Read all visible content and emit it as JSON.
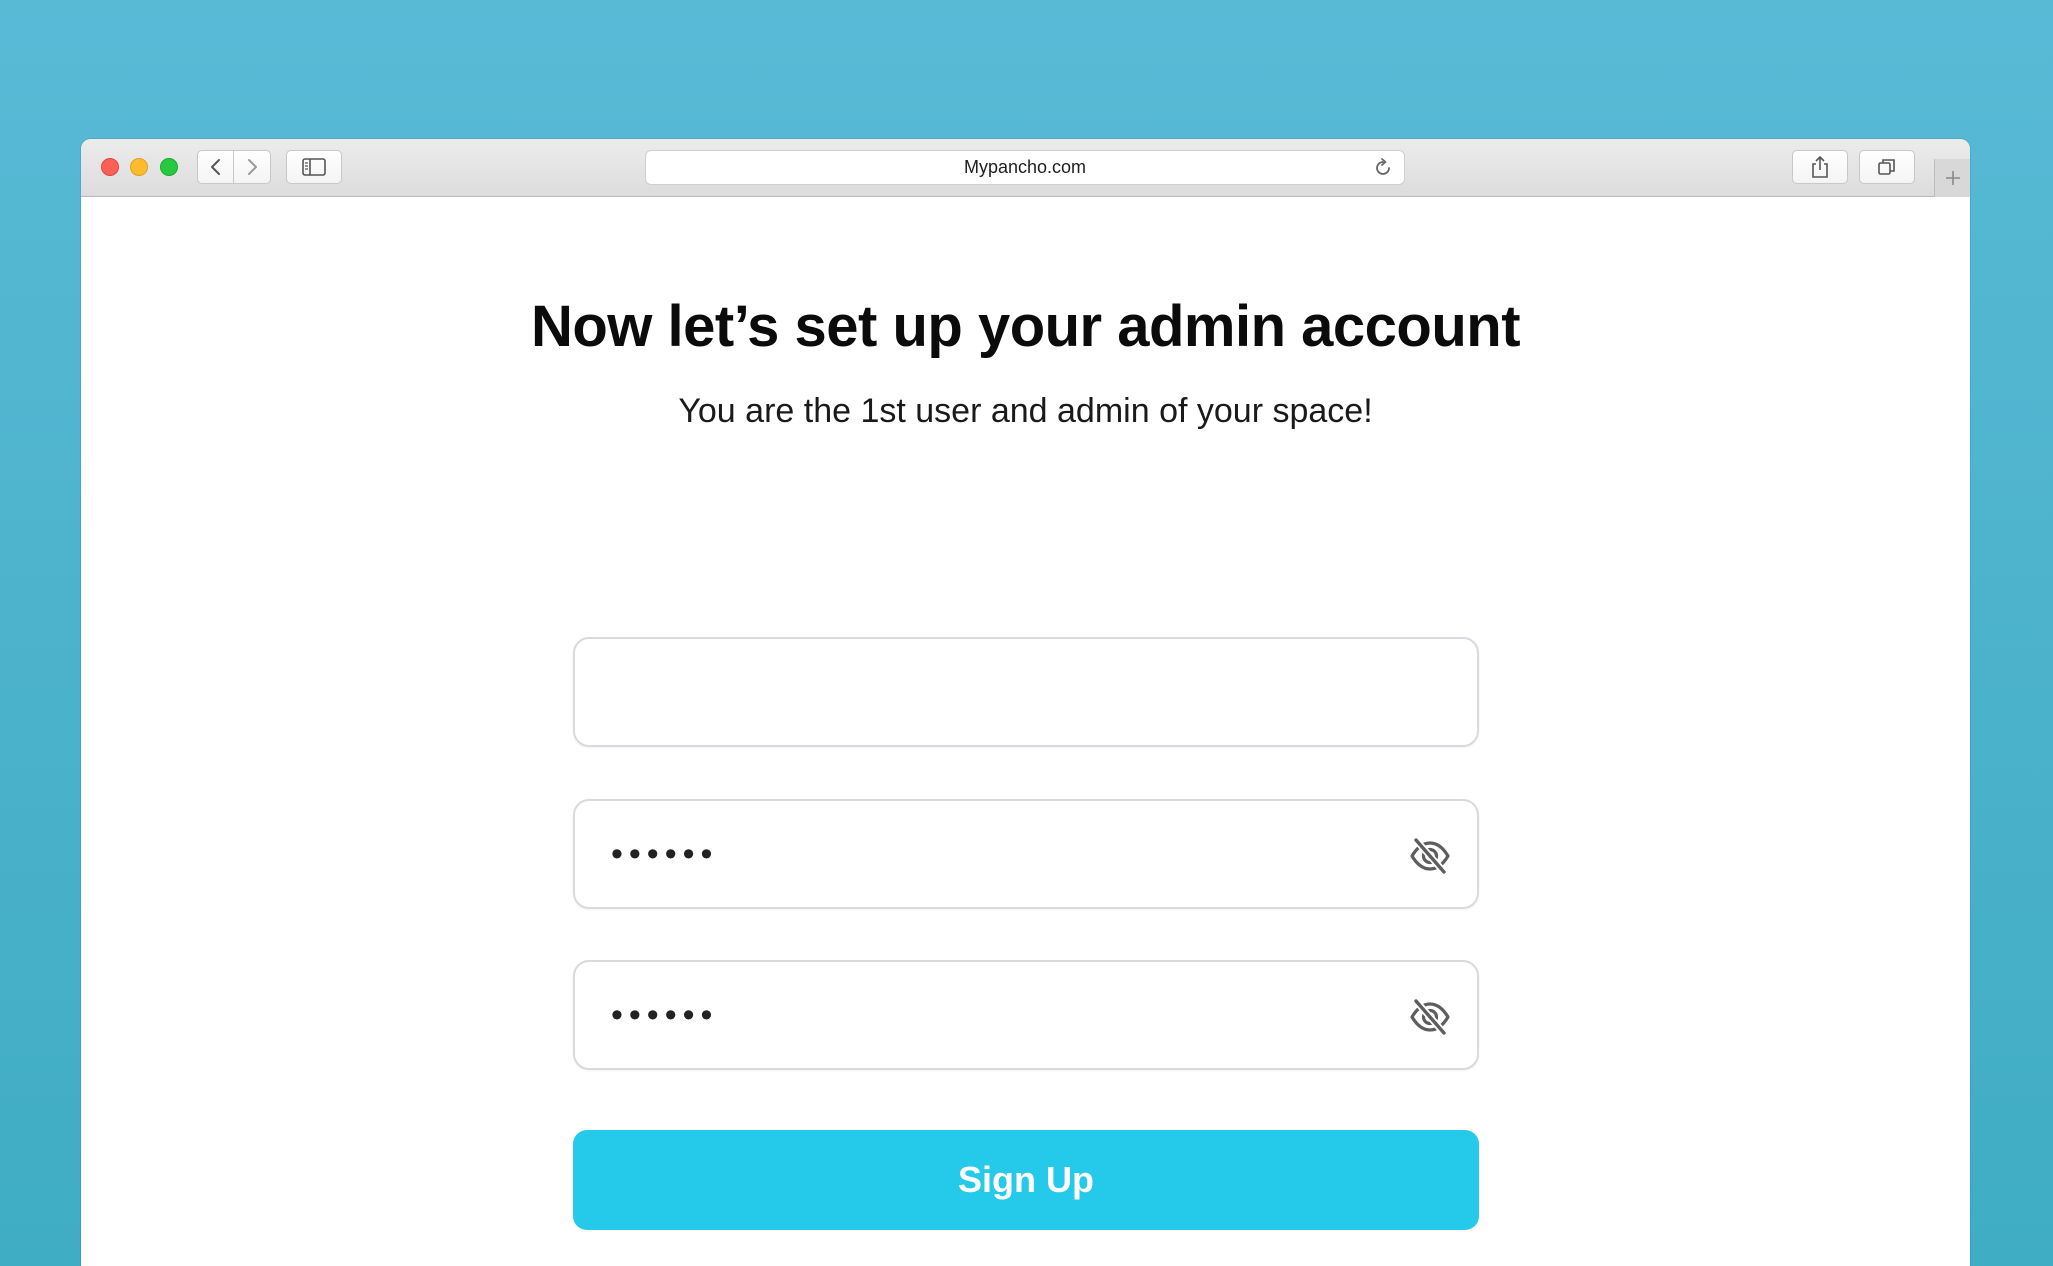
{
  "browser": {
    "url": "Mypancho.com",
    "icons": {
      "close": "close-button",
      "minimize": "minimize-button",
      "zoom": "zoom-button",
      "back": "chevron-left-icon",
      "forward": "chevron-right-icon",
      "sidebar": "sidebar-icon",
      "reload": "reload-icon",
      "share": "share-icon",
      "tabs": "tabs-overview-icon",
      "new_tab": "plus-icon"
    }
  },
  "page": {
    "heading": "Now let’s set up your admin account",
    "subheading": "You are the 1st user and admin of your space!",
    "fields": [
      {
        "value": "",
        "placeholder": ""
      },
      {
        "value": "••••••",
        "icon": "eye-slash-icon"
      },
      {
        "value": "••••••",
        "icon": "eye-slash-icon"
      }
    ],
    "signup_label": "Sign Up"
  },
  "colors": {
    "background": "#4fb4cd",
    "button": "#25c9ea",
    "button_text": "#ffffff"
  }
}
